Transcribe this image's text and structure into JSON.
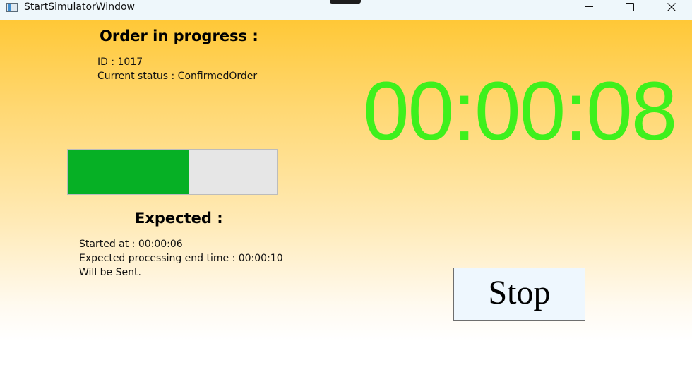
{
  "window": {
    "title": "StartSimulatorWindow",
    "icons": {
      "app": "app-window-icon",
      "minimize": "minimize-icon",
      "maximize": "maximize-icon",
      "close": "close-icon"
    }
  },
  "order": {
    "heading": "Order in progress :",
    "id_text": "ID : 1017",
    "status_text": "Current status : ConfirmedOrder"
  },
  "progress": {
    "value_percent": 58,
    "fill_color": "#06b025",
    "track_color": "#e6e6e6"
  },
  "timer": {
    "value": "00:00:08",
    "color": "#3ef01d"
  },
  "expected": {
    "heading": "Expected :",
    "started_text": "Started at : 00:00:06",
    "end_text": "Expected processing end time : 00:00:10",
    "sent_text": "Will be Sent."
  },
  "controls": {
    "stop_label": "Stop"
  },
  "colors": {
    "gradient_top": "#ffc837",
    "gradient_bottom": "#ffffff",
    "titlebar": "#eef7fb"
  }
}
